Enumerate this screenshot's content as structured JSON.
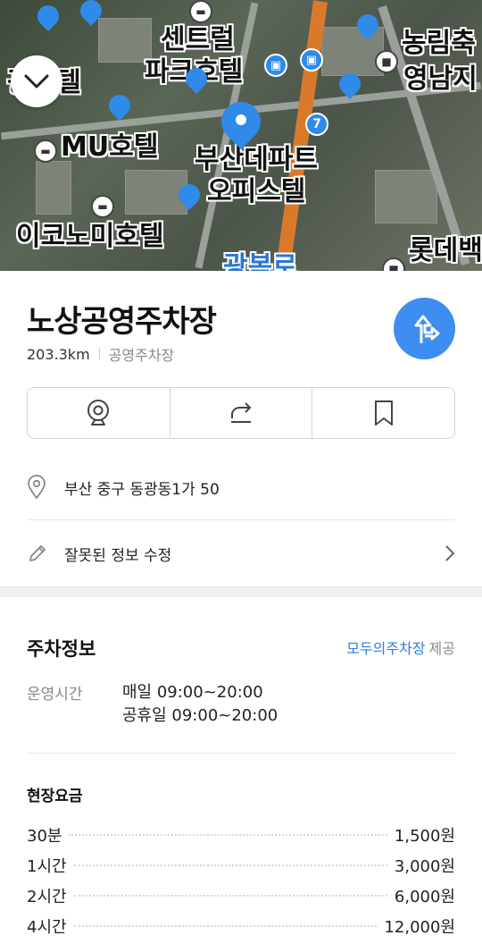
{
  "map": {
    "labels": {
      "central_park": "센트럴",
      "park_hotel": "파크호텔",
      "gwang_hotel": "광호텔",
      "mu_hotel": "MU호텔",
      "busan_depart": "부산데파트",
      "officetel": "오피스텔",
      "economy_hotel": "이코노미호텔",
      "nongrim_a": "농림축",
      "nongrim_b": "영남지",
      "lotte": "롯데백",
      "gwangbok": "광복로"
    },
    "route_number": "7",
    "colors": {
      "pin": "#2f8ae8",
      "road_highlight": "#d97a2b"
    }
  },
  "place": {
    "name": "노상공영주차장",
    "distance": "203.3km",
    "category": "공영주차장"
  },
  "address": "부산 중구 동광동1가 50",
  "edit_label": "잘못된 정보 수정",
  "parking": {
    "section_title": "주차정보",
    "provider_link": "모두의주차장",
    "provider_suffix": "제공",
    "hours_label": "운영시간",
    "hours_weekday": "매일 09:00~20:00",
    "hours_holiday": "공휴일 09:00~20:00",
    "fee_title": "현장요금",
    "fees": [
      {
        "duration": "30분",
        "price": "1,500원"
      },
      {
        "duration": "1시간",
        "price": "3,000원"
      },
      {
        "duration": "2시간",
        "price": "6,000원"
      },
      {
        "duration": "4시간",
        "price": "12,000원"
      }
    ]
  },
  "icons": {
    "collapse": "chevron-down-icon",
    "route": "directions-icon",
    "cctv": "cctv-icon",
    "share": "share-icon",
    "bookmark": "bookmark-icon",
    "location": "location-pin-icon",
    "edit": "pencil-icon",
    "chevron": "chevron-right-icon"
  },
  "accent_color": "#3d8ef0"
}
